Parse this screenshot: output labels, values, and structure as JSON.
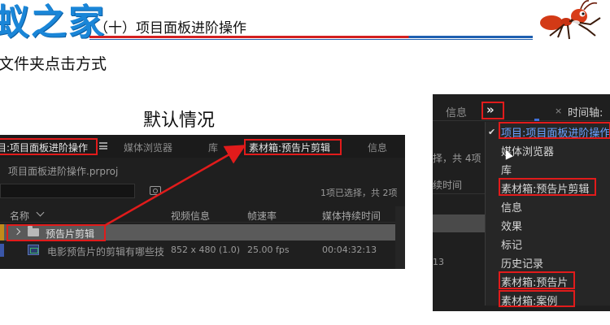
{
  "header": {
    "logo_title": "蚁之家",
    "slide_heading": "（十）项目面板进阶操作",
    "subheading": "文件夹点击方式",
    "default_caption": "默认情况"
  },
  "left_panel": {
    "tabs": {
      "project": "目:项目面板进阶操作",
      "media_browser": "媒体浏览器",
      "library": "库",
      "bin_trailer_edit": "素材箱:预告片剪辑",
      "info": "信息"
    },
    "project_path": "项目面板进阶操作.prproj",
    "search_placeholder": "",
    "selection_info": "1项已选择，共 2项",
    "columns": {
      "name": "名称",
      "video_info": "视频信息",
      "frame_rate": "帧速率",
      "media_duration": "媒体持续时间"
    },
    "rows": [
      {
        "name": "预告片剪辑",
        "type": "folder",
        "video_info": "",
        "frame_rate": "",
        "duration": ""
      },
      {
        "name": "电影预告片的剪辑有哪些技",
        "type": "clip",
        "video_info": "852 x 480 (1.0)",
        "frame_rate": "25.00 fps",
        "duration": "00:04:32:13"
      }
    ]
  },
  "right_panel": {
    "tab_info": "信息",
    "more_button": "»",
    "close_glyph": "×",
    "timeline_tab": "时间轴:",
    "bg_selection": "择，共 4项",
    "bg_duration": "续时间",
    "bg_13": "13",
    "menu": [
      {
        "label": "项目:项目面板进阶操作",
        "checked": true
      },
      {
        "label": "媒体浏览器",
        "checked": false
      },
      {
        "label": "库",
        "checked": false
      },
      {
        "label": "素材箱:预告片剪辑",
        "checked": false
      },
      {
        "label": "信息",
        "checked": false
      },
      {
        "label": "效果",
        "checked": false
      },
      {
        "label": "标记",
        "checked": false
      },
      {
        "label": "历史记录",
        "checked": false
      },
      {
        "label": "素材箱:预告片",
        "checked": false
      },
      {
        "label": "素材箱:案例",
        "checked": false
      }
    ]
  },
  "colors": {
    "highlight_red": "#e11b1b",
    "logo_blue": "#1a86d8",
    "panel_bg": "#1f1f1f",
    "checked_blue": "#6aa0ff"
  }
}
